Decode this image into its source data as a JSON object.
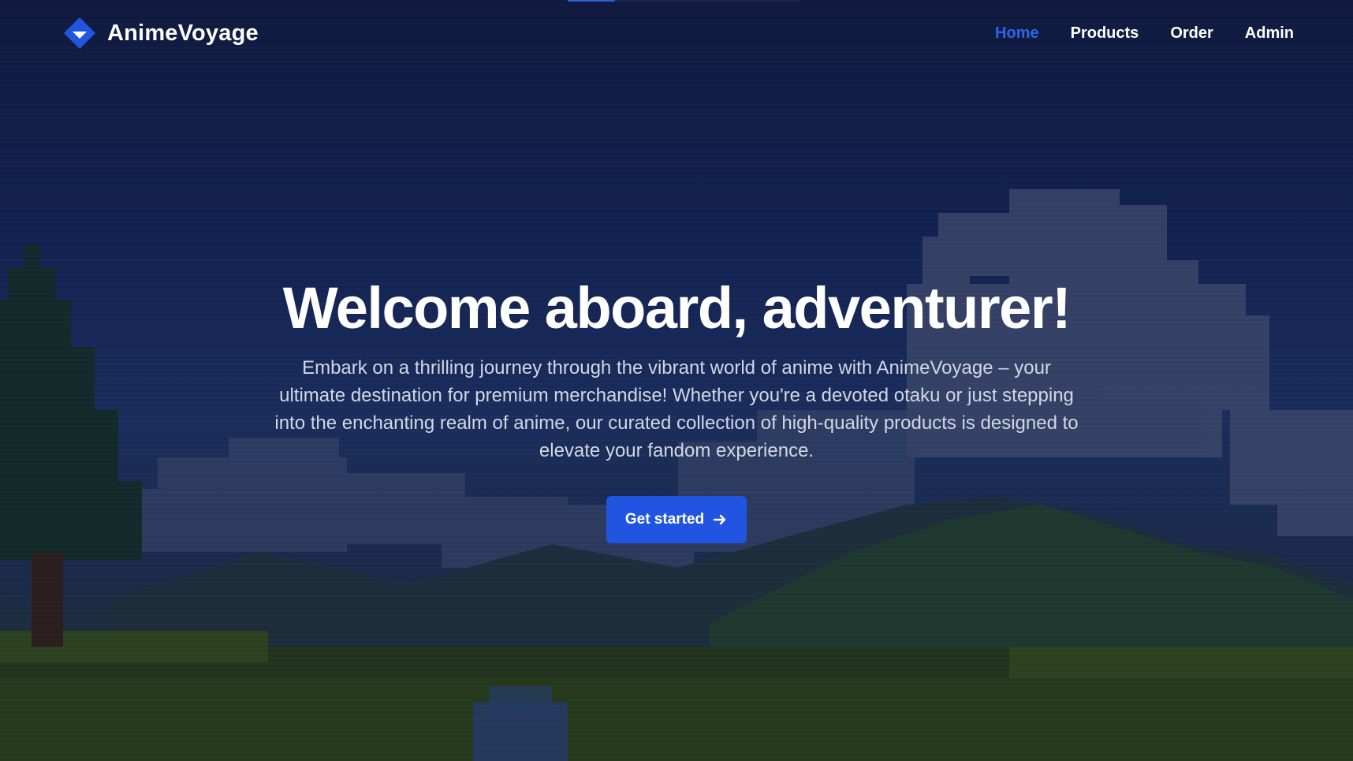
{
  "brand": {
    "name": "AnimeVoyage",
    "logo_icon": "diamond-chevron-icon",
    "accent_color": "#2f64e8"
  },
  "nav": {
    "items": [
      {
        "label": "Home",
        "active": true
      },
      {
        "label": "Products",
        "active": false
      },
      {
        "label": "Order",
        "active": false
      },
      {
        "label": "Admin",
        "active": false
      }
    ]
  },
  "hero": {
    "title": "Welcome aboard, adventurer!",
    "description": "Embark on a thrilling journey through the vibrant world of anime with AnimeVoyage – your ultimate destination for premium merchandise! Whether you're a devoted otaku or just stepping into the enchanting realm of anime, our curated collection of high-quality products is designed to elevate your fandom experience.",
    "cta_label": "Get started",
    "cta_icon": "arrow-right-icon",
    "cta_color": "#2155e1"
  },
  "background": {
    "description_icon": "pixel-landscape-illustration"
  }
}
